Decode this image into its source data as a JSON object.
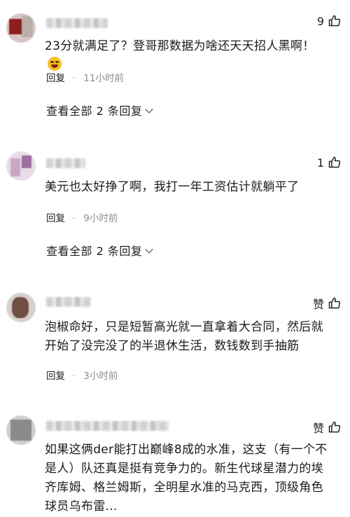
{
  "comments": [
    {
      "text": "23分就满足了？登哥那数据为啥还天天招人黑啊！",
      "reply_label": "回复",
      "time": "11小时前",
      "like_count": "9",
      "view_replies": "查看全部 2 条回复"
    },
    {
      "text": "美元也太好挣了啊，我打一年工资估计就躺平了",
      "reply_label": "回复",
      "time": "9小时前",
      "like_count": "1",
      "view_replies": "查看全部 2 条回复"
    },
    {
      "text": "泡椒命好，只是短暂高光就一直拿着大合同，然后就开始了没完没了的半退休生活，数钱数到手抽筋",
      "reply_label": "回复",
      "time": "3小时前",
      "like_count": "赞"
    },
    {
      "text": "如果这俩der能打出巅峰8成的水准，这支（有一个不是人）队还真是挺有竞争力的。新生代球星潜力的埃齐库姆、格兰姆斯，全明星水准的马克西，顶级角色球员乌布雷...",
      "like_count": "赞"
    }
  ],
  "icons": {
    "like": "thumbs-up-icon",
    "emoji": "laughing-crying-emoji-icon",
    "expand": "chevron-down-icon"
  },
  "colors": {
    "text": "#1b1b1b",
    "meta": "#8c8c8c",
    "background": "#ffffff"
  }
}
